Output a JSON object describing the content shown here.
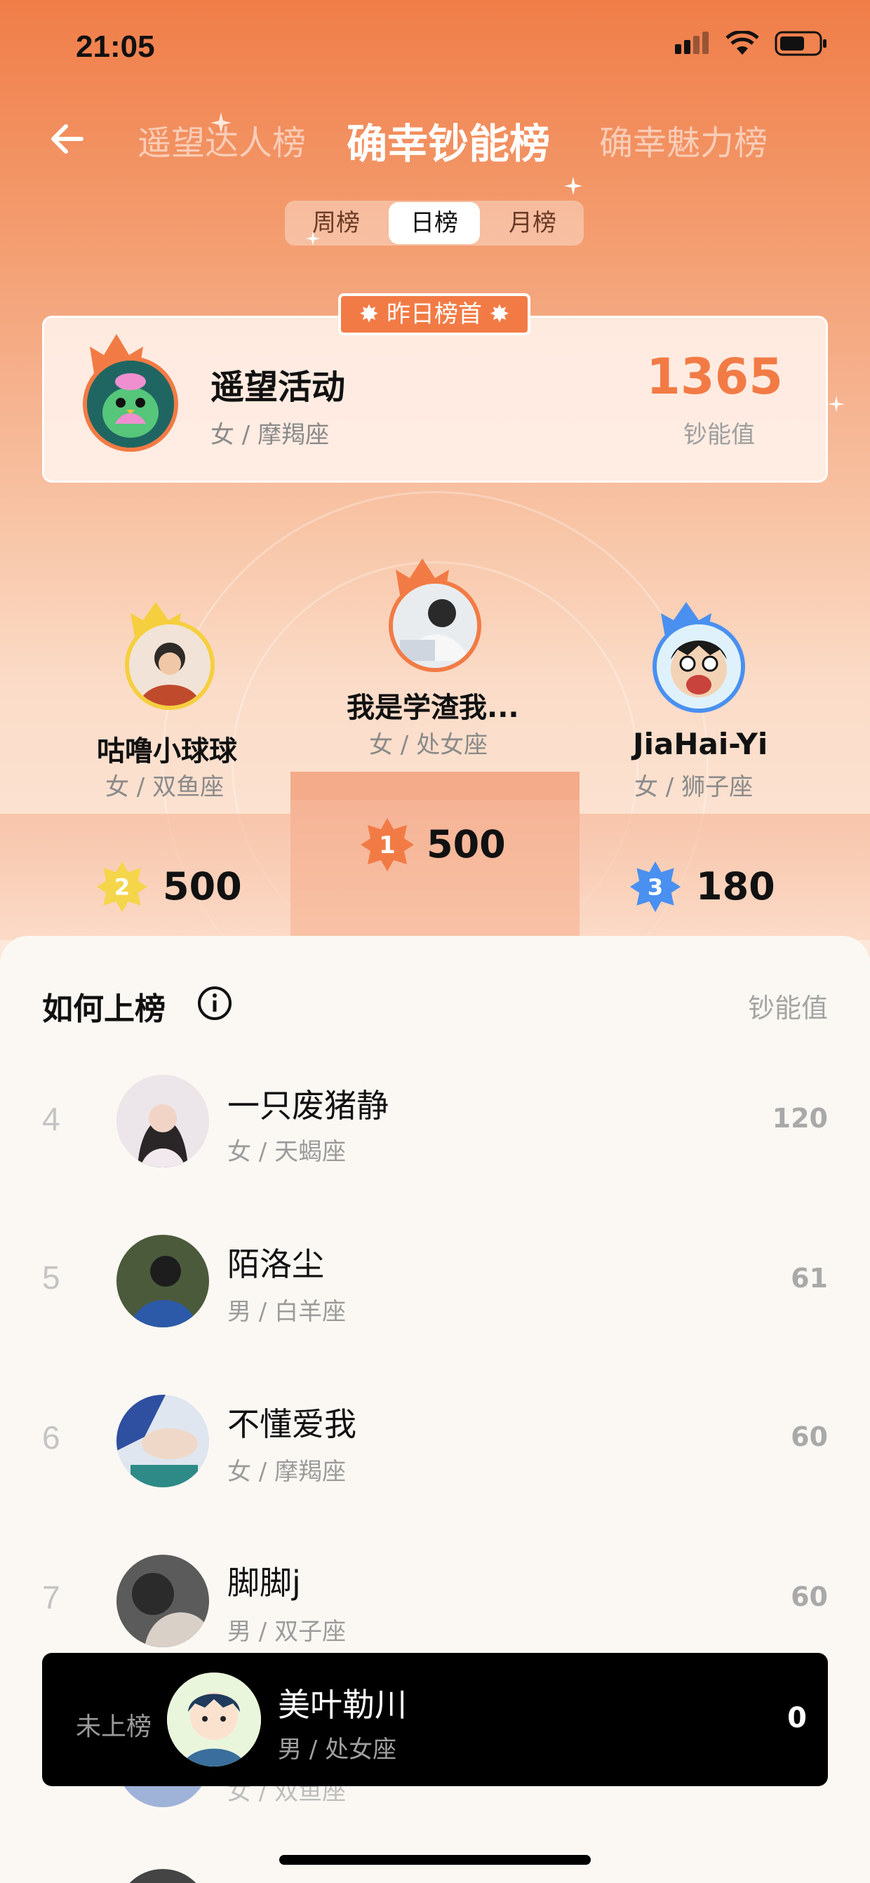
{
  "status": {
    "time": "21:05"
  },
  "nav": {
    "tabs": [
      "遥望达人榜",
      "确幸钞能榜",
      "确幸魅力榜"
    ],
    "active_tab": 1
  },
  "period": {
    "options": [
      "周榜",
      "日榜",
      "月榜"
    ],
    "selected": "日榜"
  },
  "yesterday_top": {
    "tag": "昨日榜首",
    "name": "遥望活动",
    "sub": "女 / 摩羯座",
    "score": "1365",
    "score_label": "钞能值"
  },
  "podium": {
    "first": {
      "rank": "1",
      "name": "我是学渣我...",
      "sub": "女 / 处女座",
      "score": "500"
    },
    "second": {
      "rank": "2",
      "name": "咕噜小球球",
      "sub": "女 / 双鱼座",
      "score": "500"
    },
    "third": {
      "rank": "3",
      "name": "JiaHai-Yi",
      "sub": "女 / 狮子座",
      "score": "180"
    }
  },
  "list": {
    "how_to": "如何上榜",
    "column": "钞能值",
    "rows": [
      {
        "rank": "4",
        "name": "一只废猪静",
        "sub": "女 / 天蝎座",
        "score": "120"
      },
      {
        "rank": "5",
        "name": "陌洛尘",
        "sub": "男 / 白羊座",
        "score": "61"
      },
      {
        "rank": "6",
        "name": "不懂爱我",
        "sub": "女 / 摩羯座",
        "score": "60"
      },
      {
        "rank": "7",
        "name": "脚脚j",
        "sub": "男 / 双子座",
        "score": "60"
      },
      {
        "sub": "女 / 双鱼座"
      }
    ]
  },
  "me": {
    "status": "未上榜",
    "name": "美叶勒川",
    "sub": "男 / 处女座",
    "score": "0"
  },
  "colors": {
    "accent": "#f27b45",
    "gold": "#f5cf3e",
    "blue": "#4a90f0"
  }
}
